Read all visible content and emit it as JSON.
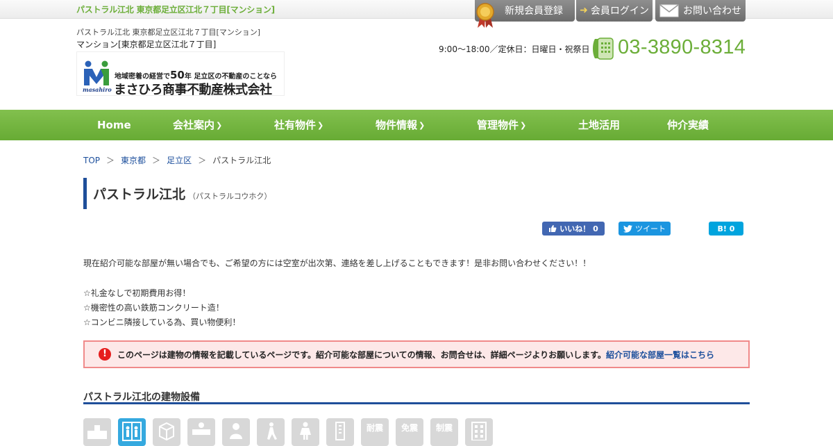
{
  "topbar": {
    "site_title": "パストラル江北 東京都足立区江北７丁目[マンション]",
    "register_label": "新規会員登録",
    "login_label": "会員ログイン",
    "contact_label": "お問い合わせ"
  },
  "header": {
    "sub1": "パストラル江北 東京都足立区江北７丁目[マンション]",
    "sub2": "マンション[東京都足立区江北７丁目]",
    "logo_tagline_pre": "地域密着の経営で",
    "logo_tagline_num": "50",
    "logo_tagline_post": "年 足立区の不動産のことなら",
    "logo_company": "まさひろ商事不動産株式会社",
    "logo_brand": "masahiro",
    "hours": "9:00～18:00／定休日：日曜日・祝祭日",
    "phone": "03-3890-8314"
  },
  "nav": [
    {
      "label": "Home",
      "dropdown": false
    },
    {
      "label": "会社案内",
      "dropdown": true
    },
    {
      "label": "社有物件",
      "dropdown": true
    },
    {
      "label": "物件情報",
      "dropdown": true
    },
    {
      "label": "管理物件",
      "dropdown": true
    },
    {
      "label": "土地活用",
      "dropdown": false
    },
    {
      "label": "仲介実績",
      "dropdown": false
    }
  ],
  "breadcrumb": {
    "top": "TOP",
    "pref": "東京都",
    "city": "足立区",
    "current": "パストラル江北",
    "sep": "＞"
  },
  "title": {
    "name": "パストラル江北",
    "kana": "（パストラルコウホク）"
  },
  "sns": {
    "fb_label": "いいね！ 0",
    "tw_label": "ツイート",
    "hb_label": "B! 0"
  },
  "body": {
    "intro": "現在紹介可能な部屋が無い場合でも、ご希望の方には空室が出次第、連絡を差し上げることもできます！是非お問い合わせください！！",
    "points": [
      "☆礼金なしで初期費用お得！",
      "☆機密性の高い鉄筋コンクリート造！",
      "☆コンビニ隣接している為、買い物便利！"
    ]
  },
  "notice": {
    "icon": "!",
    "message": "このページは建物の情報を記載しているページです。紹介可能な部屋についての情報、お問合せは、詳細ページよりお願いします。",
    "link": "紹介可能な部屋一覧はこちら"
  },
  "facilities": {
    "heading": "パストラル江北の建物設備",
    "icons": [
      {
        "name": "delivery-box-icon",
        "active": false,
        "text": ""
      },
      {
        "name": "elevator-icon",
        "active": true,
        "text": ""
      },
      {
        "name": "trash-box-icon",
        "active": false,
        "text": ""
      },
      {
        "name": "lobby-icon",
        "active": false,
        "text": ""
      },
      {
        "name": "manager-icon",
        "active": false,
        "text": ""
      },
      {
        "name": "barrier-free-icon",
        "active": false,
        "text": ""
      },
      {
        "name": "women-only-icon",
        "active": false,
        "text": ""
      },
      {
        "name": "high-rise-icon",
        "active": false,
        "text": ""
      },
      {
        "name": "earthquake-resistant-icon",
        "active": false,
        "text": "耐震"
      },
      {
        "name": "seismic-isolation-icon",
        "active": false,
        "text": "免震"
      },
      {
        "name": "vibration-control-icon",
        "active": false,
        "text": "制震"
      },
      {
        "name": "building-icon",
        "active": false,
        "text": ""
      }
    ]
  },
  "colors": {
    "brand_green": "#6cae39",
    "nav_green": "#74b540",
    "accent_blue": "#1f4f9a",
    "alert_red": "#e61e1e"
  }
}
